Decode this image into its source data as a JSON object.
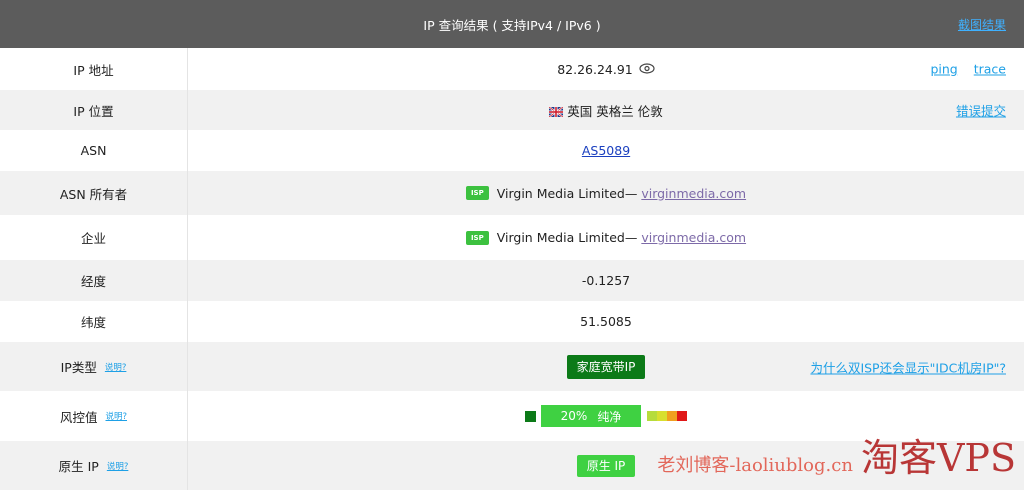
{
  "header": {
    "title": "IP 查询结果 ( 支持IPv4 / IPv6 )",
    "screenshot_link": "截图结果"
  },
  "rows": {
    "ip": {
      "label": "IP 地址",
      "value": "82.26.24.91",
      "icon": "eye-icon",
      "links": [
        "ping",
        "trace"
      ]
    },
    "location": {
      "label": "IP 位置",
      "flag": "uk-flag-icon",
      "value": "英国 英格兰 伦敦",
      "link": "错误提交"
    },
    "asn": {
      "label": "ASN",
      "value": "AS5089"
    },
    "asn_owner": {
      "label": "ASN 所有者",
      "badge": "ISP",
      "name": "Virgin Media Limited—",
      "domain": "virginmedia.com"
    },
    "company": {
      "label": "企业",
      "badge": "ISP",
      "name": "Virgin Media Limited—",
      "domain": "virginmedia.com"
    },
    "longitude": {
      "label": "经度",
      "value": "-0.1257"
    },
    "latitude": {
      "label": "纬度",
      "value": "51.5085"
    },
    "ip_type": {
      "label": "IP类型",
      "help": "说明?",
      "value": "家庭宽带IP",
      "link": "为什么双ISP还会显示\"IDC机房IP\"?"
    },
    "risk": {
      "label": "风控值",
      "help": "说明?",
      "percent": "20%",
      "grade": "纯净",
      "level": 0.2
    },
    "native": {
      "label": "原生 IP",
      "help": "说明?",
      "value": "原生 IP"
    }
  },
  "watermark": {
    "part1": "老刘博客-laoliublog.cn",
    "part2": "淘客VPS"
  },
  "colors": {
    "header_bg": "#5c5c5c",
    "link": "#1ea0e6",
    "dark_green": "#0c7a18",
    "green": "#3fd142"
  }
}
